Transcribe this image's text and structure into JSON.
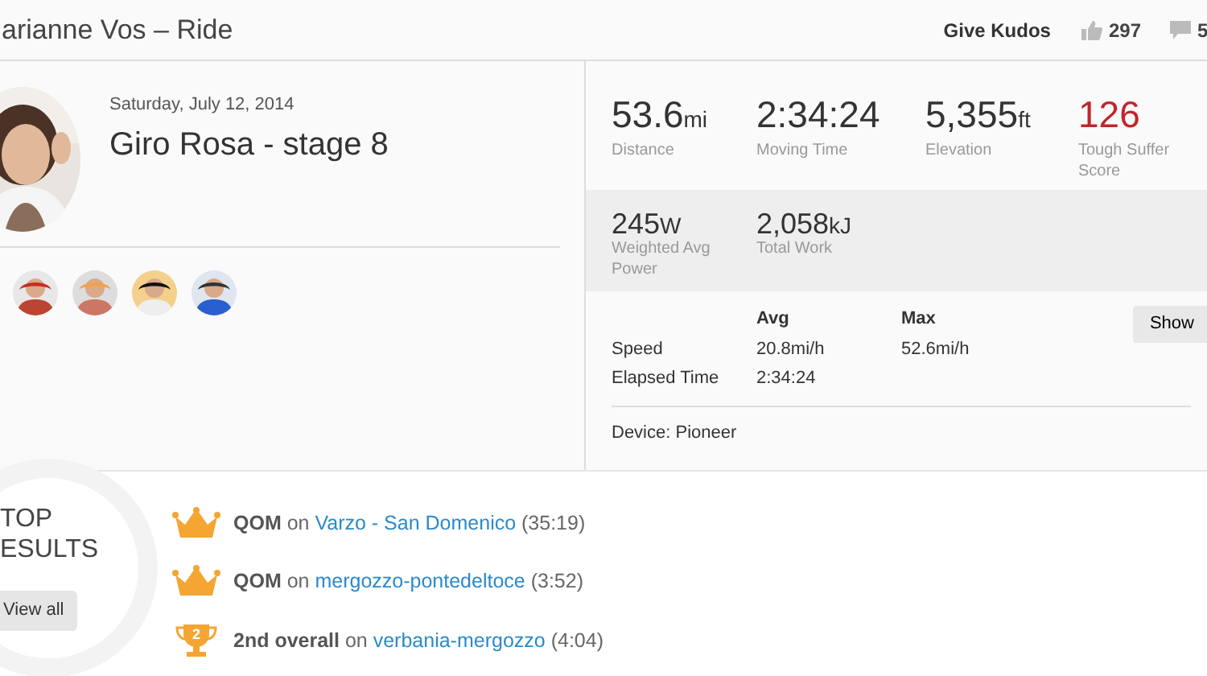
{
  "header": {
    "title": "arianne Vos – Ride",
    "kudos_button": "Give Kudos",
    "kudos_count": "297",
    "comment_count": "5"
  },
  "activity": {
    "date": "Saturday, July 12, 2014",
    "title": "Giro Rosa - stage 8"
  },
  "stats": [
    {
      "value": "53.6",
      "unit": "mi",
      "label": "Distance",
      "highlight": false
    },
    {
      "value": "2:34:24",
      "label": "Moving Time",
      "highlight": false
    },
    {
      "value": "5,355",
      "unit": "ft",
      "label": "Elevation",
      "highlight": false
    },
    {
      "value": "126",
      "label": "Tough Suffer Score",
      "highlight": true
    }
  ],
  "secondary_stats": [
    {
      "value": "245",
      "unit": "W",
      "label": "Weighted Avg Power"
    },
    {
      "value": "2,058",
      "unit": "kJ",
      "label": "Total Work"
    }
  ],
  "details": {
    "columns": [
      "Avg",
      "Max"
    ],
    "show_button": "Show",
    "rows": [
      {
        "label": "Speed",
        "avg": "20.8mi/h",
        "max": "52.6mi/h"
      },
      {
        "label": "Elapsed Time",
        "avg": "2:34:24"
      }
    ],
    "device": "Device: Pioneer"
  },
  "top_results": {
    "heading": [
      "TOP",
      "ESULTS"
    ],
    "view_all": "View all",
    "items": [
      {
        "kind": "crown",
        "title": "**QOM** on",
        "segment": "Varzo - San Domenico",
        "time": "(35:19)"
      },
      {
        "kind": "crown",
        "title": "**QOM** on",
        "segment": "mergozzo-pontedeltoce",
        "time": "(3:52)"
      },
      {
        "kind": "trophy",
        "rank": "2",
        "title": "**2nd overall** on",
        "segment": "verbania-mergozzo",
        "time": "(4:04)"
      }
    ]
  }
}
